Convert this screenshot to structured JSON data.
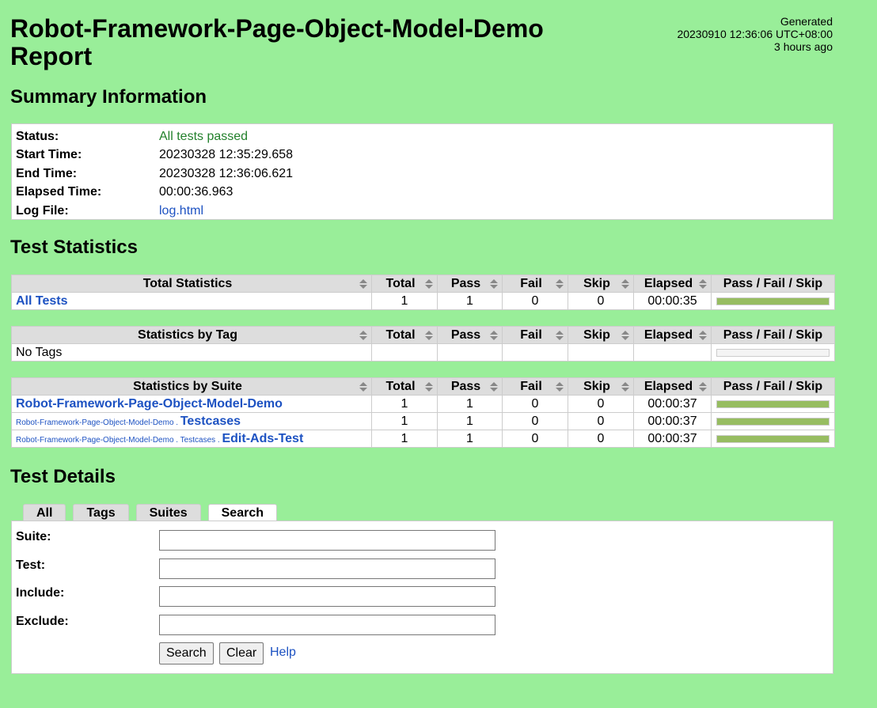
{
  "header": {
    "title": "Robot-Framework-Page-Object-Model-Demo Report",
    "generated_label": "Generated",
    "generated_time": "20230910 12:36:06 UTC+08:00",
    "generated_ago": "3 hours ago"
  },
  "summary": {
    "heading": "Summary Information",
    "rows": [
      {
        "label": "Status:",
        "value": "All tests passed"
      },
      {
        "label": "Start Time:",
        "value": "20230328 12:35:29.658"
      },
      {
        "label": "End Time:",
        "value": "20230328 12:36:06.621"
      },
      {
        "label": "Elapsed Time:",
        "value": "00:00:36.963"
      },
      {
        "label": "Log File:",
        "value": "log.html"
      }
    ]
  },
  "statistics": {
    "heading": "Test Statistics",
    "columns": [
      "Total",
      "Pass",
      "Fail",
      "Skip",
      "Elapsed",
      "Pass / Fail / Skip"
    ],
    "total": {
      "header": "Total Statistics",
      "rows": [
        {
          "name": "All Tests",
          "total": "1",
          "pass": "1",
          "fail": "0",
          "skip": "0",
          "elapsed": "00:00:35",
          "pass_fraction": 1.0
        }
      ]
    },
    "tag": {
      "header": "Statistics by Tag",
      "rows": [
        {
          "name": "No Tags",
          "pass_fraction": 0
        }
      ]
    },
    "suite": {
      "header": "Statistics by Suite",
      "rows": [
        {
          "parent": "",
          "name": "Robot-Framework-Page-Object-Model-Demo",
          "total": "1",
          "pass": "1",
          "fail": "0",
          "skip": "0",
          "elapsed": "00:00:37",
          "pass_fraction": 1.0
        },
        {
          "parent": "Robot-Framework-Page-Object-Model-Demo . ",
          "name": "Testcases",
          "total": "1",
          "pass": "1",
          "fail": "0",
          "skip": "0",
          "elapsed": "00:00:37",
          "pass_fraction": 1.0
        },
        {
          "parent": "Robot-Framework-Page-Object-Model-Demo . Testcases . ",
          "name": "Edit-Ads-Test",
          "total": "1",
          "pass": "1",
          "fail": "0",
          "skip": "0",
          "elapsed": "00:00:37",
          "pass_fraction": 1.0
        }
      ]
    }
  },
  "details": {
    "heading": "Test Details",
    "tabs": [
      "All",
      "Tags",
      "Suites",
      "Search"
    ],
    "active_tab": "Search",
    "fields": [
      {
        "label": "Suite:",
        "value": ""
      },
      {
        "label": "Test:",
        "value": ""
      },
      {
        "label": "Include:",
        "value": ""
      },
      {
        "label": "Exclude:",
        "value": ""
      }
    ],
    "search_button": "Search",
    "clear_button": "Clear",
    "help_link": "Help"
  },
  "colors": {
    "background": "#99ee99",
    "pass": "#97bd61",
    "link": "#1d52c2"
  }
}
